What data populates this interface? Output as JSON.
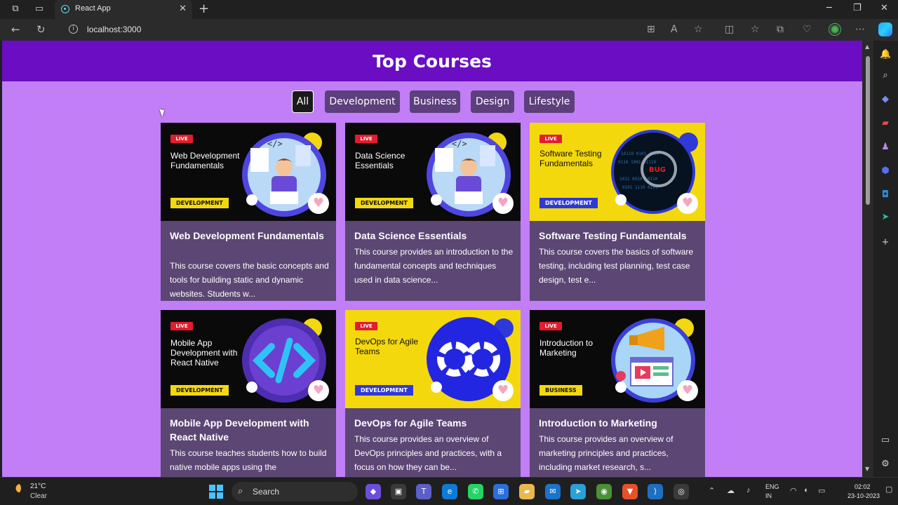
{
  "browser": {
    "tab_title": "React App",
    "url": "localhost:3000"
  },
  "page": {
    "title": "Top Courses",
    "filters": [
      {
        "label": "All",
        "active": true
      },
      {
        "label": "Development",
        "active": false
      },
      {
        "label": "Business",
        "active": false
      },
      {
        "label": "Design",
        "active": false
      },
      {
        "label": "Lifestyle",
        "active": false
      }
    ]
  },
  "courses": [
    {
      "thumb_label": "Web Development Fundamentals",
      "live_label": "LIVE",
      "tag": "DEVELOPMENT",
      "title": "Web Development Fundamentals",
      "description": "This course covers the basic concepts and tools for building static and dynamic websites. Students w...",
      "thumb_style": "dark",
      "art": "developer-illustration"
    },
    {
      "thumb_label": "Data Science Essentials",
      "live_label": "LIVE",
      "tag": "DEVELOPMENT",
      "title": "Data Science Essentials",
      "description": "This course provides an introduction to the fundamental concepts and techniques used in data science...",
      "thumb_style": "dark",
      "art": "developer-illustration"
    },
    {
      "thumb_label": "Software Testing Fundamentals",
      "live_label": "LIVE",
      "tag": "DEVELOPMENT",
      "title": "Software Testing Fundamentals",
      "description": "This course covers the basics of software testing, including test planning, test case design, test e...",
      "thumb_style": "yellow",
      "art": "bug-magnifier"
    },
    {
      "thumb_label": "Mobile App Development with React Native",
      "live_label": "LIVE",
      "tag": "DEVELOPMENT",
      "title": "Mobile App Development with React Native",
      "description": "This course teaches students how to build native mobile apps using the",
      "thumb_style": "dark",
      "art": "code-brackets"
    },
    {
      "thumb_label": "DevOps for Agile Teams",
      "live_label": "LIVE",
      "tag": "DEVELOPMENT",
      "title": "DevOps for Agile Teams",
      "description": "This course provides an overview of DevOps principles and practices, with a focus on how they can be...",
      "thumb_style": "yellow",
      "art": "infinity-loop"
    },
    {
      "thumb_label": "Introduction to Marketing",
      "live_label": "LIVE",
      "tag": "BUSINESS",
      "title": "Introduction to Marketing",
      "description": "This course provides an overview of marketing principles and practices, including market research, s...",
      "thumb_style": "dark",
      "art": "megaphone-browser"
    }
  ],
  "taskbar": {
    "temperature": "21°C",
    "condition": "Clear",
    "search_label": "Search",
    "lang_line1": "ENG",
    "lang_line2": "IN",
    "time": "02:02",
    "date": "23-10-2023"
  },
  "colors": {
    "header_bg": "#6a0dc3",
    "page_bg": "#c17ef7",
    "card_bg": "#5b4674",
    "filter_bg": "#5c3f7b",
    "tag_yellow": "#f4d80e",
    "tag_blue": "#2f39d8"
  }
}
